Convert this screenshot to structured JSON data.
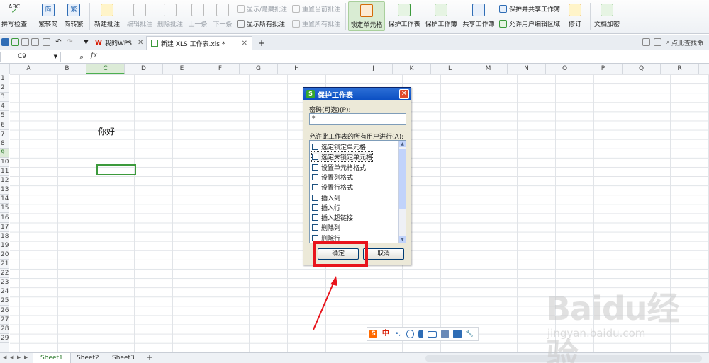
{
  "ribbon": {
    "spell_check": "拼写检查",
    "trad_to_simp": "繁转简",
    "simp_to_trad": "简转繁",
    "new_comment": "新建批注",
    "edit_comment": "编辑批注",
    "delete_comment": "删除批注",
    "prev": "上一条",
    "next": "下一条",
    "show_hide_comment": "显示/隐藏批注",
    "reset_current_comment": "重置当前批注",
    "show_all_comments": "显示所有批注",
    "reset_all_comments": "重置所有批注",
    "lock_cell": "锁定单元格",
    "protect_sheet": "保护工作表",
    "protect_workbook": "保护工作簿",
    "share_workbook": "共享工作簿",
    "protect_shared_workbook": "保护并共享工作簿",
    "allow_user_edit_ranges": "允许用户编辑区域",
    "revise": "修订",
    "doc_encrypt": "文档加密"
  },
  "tabs": {
    "wps_tab": "我的WPS",
    "doc_tab": "新建 XLS 工作表.xls *",
    "new_tab_symbol": "+"
  },
  "search": {
    "label": "点此查找命"
  },
  "formula_bar": {
    "cell_ref": "C9",
    "fx": "fx"
  },
  "grid": {
    "columns": [
      "A",
      "B",
      "C",
      "D",
      "E",
      "F",
      "G",
      "H",
      "I",
      "J",
      "K",
      "L",
      "M",
      "N",
      "O",
      "P",
      "Q",
      "R"
    ],
    "rows": [
      "1",
      "2",
      "3",
      "4",
      "5",
      "6",
      "7",
      "8",
      "9",
      "10",
      "11",
      "12",
      "13",
      "14",
      "15",
      "16",
      "17",
      "18",
      "19",
      "20",
      "21",
      "22",
      "23",
      "24",
      "25",
      "26",
      "27",
      "28",
      "29"
    ],
    "selected_column": "C",
    "selected_row": "9",
    "cell_c5": "你好"
  },
  "sheets": [
    "Sheet1",
    "Sheet2",
    "Sheet3"
  ],
  "sheet_add": "+",
  "dialog": {
    "title": "保护工作表",
    "logo": "S",
    "close": "✕",
    "password_label": "密码(可选)(P):",
    "password_value": "*",
    "permissions_label": "允许此工作表的所有用户进行(A):",
    "permissions": [
      "选定锁定单元格",
      "选定未锁定单元格",
      "设置单元格格式",
      "设置列格式",
      "设置行格式",
      "插入列",
      "插入行",
      "插入超链接",
      "删除列",
      "删除行"
    ],
    "ok_label": "确定",
    "cancel_label": "取消"
  },
  "ime": {
    "brand": "S",
    "mode": "中",
    "punct": "•,"
  },
  "watermark": {
    "brand": "Baidu经验",
    "url": "jingyan.baidu.com"
  },
  "colors": {
    "accent_green": "#3c9a3c",
    "highlight_red": "#e8141c",
    "dialog_title_blue": "#0a4ec2"
  }
}
